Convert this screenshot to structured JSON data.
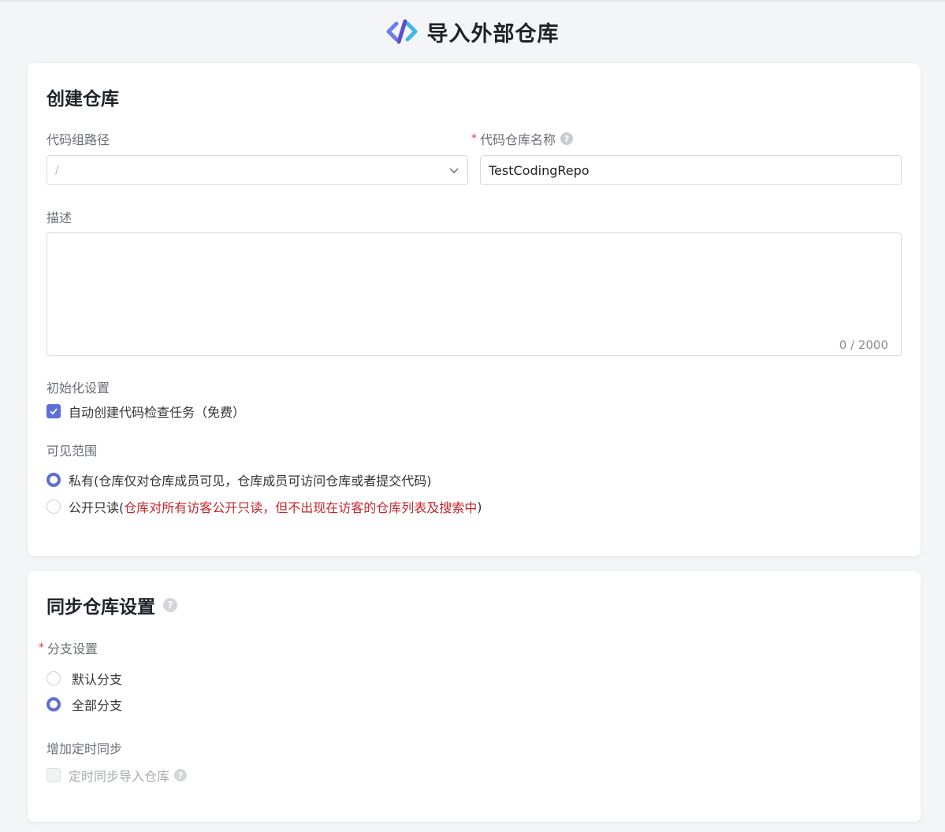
{
  "header": {
    "title": "导入外部仓库"
  },
  "create": {
    "title": "创建仓库",
    "group_path_label": "代码组路径",
    "group_path_placeholder": "/",
    "repo_name_label": "代码仓库名称",
    "repo_name_value": "TestCodingRepo",
    "description_label": "描述",
    "description_counter": "0 / 2000",
    "init_label": "初始化设置",
    "init_option": "自动创建代码检查任务（免费）",
    "init_checked": true,
    "visibility_label": "可见范围",
    "visibility_private": "私有(仓库仅对仓库成员可见，仓库成员可访问仓库或者提交代码)",
    "visibility_public_prefix": "公开只读(",
    "visibility_public_note": "仓库对所有访客公开只读，但不出现在访客的仓库列表及搜索中",
    "visibility_public_suffix": " )",
    "visibility_selected": "private"
  },
  "sync": {
    "title": "同步仓库设置",
    "branch_label": "分支设置",
    "branch_default": "默认分支",
    "branch_all": "全部分支",
    "branch_selected": "all",
    "schedule_label": "增加定时同步",
    "schedule_option": "定时同步导入仓库",
    "schedule_enabled": false
  },
  "icons": {
    "logo": "coding-logo-icon",
    "help": "help-circle-icon",
    "chevron": "chevron-down-icon",
    "check": "check-icon"
  },
  "colors": {
    "accent": "#5b6fd6",
    "required": "#e03a3a",
    "warning_text": "#c2262b"
  }
}
